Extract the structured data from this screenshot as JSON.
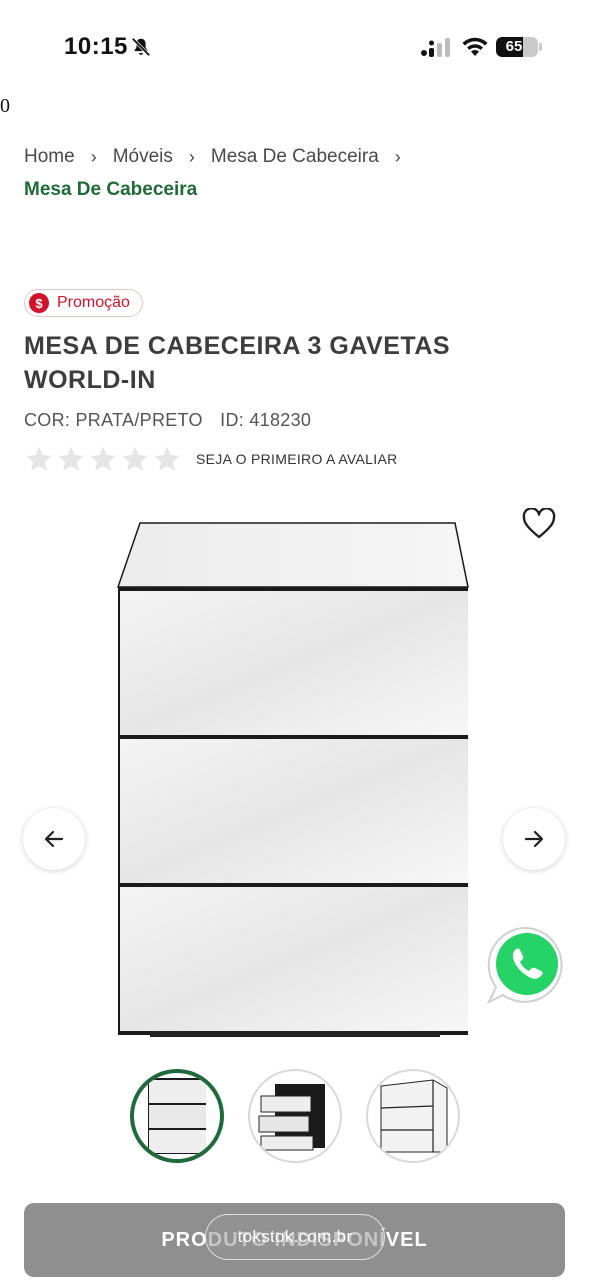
{
  "status_bar": {
    "time": "10:15",
    "battery": "65",
    "battery_level": 0.65
  },
  "stray_char": "0",
  "breadcrumb": {
    "items": [
      "Home",
      "Móveis",
      "Mesa De Cabeceira"
    ],
    "current": "Mesa De Cabeceira"
  },
  "promo": {
    "icon_symbol": "$",
    "label": "Promoção"
  },
  "product": {
    "title": "MESA DE CABECEIRA 3 GAVETAS WORLD-IN",
    "color": "COR: PRATA/PRETO",
    "id": "ID: 418230",
    "rating_stars": 0,
    "rating_text": "SEJA O PRIMEIRO A AVALIAR"
  },
  "cta": {
    "label": "PRODUTO INDISPONÍVEL"
  },
  "browser": {
    "url": "tokstok.com.br"
  },
  "colors": {
    "brand_green": "#1e6b39",
    "promo_red": "#d1132a",
    "cta_gray": "#8f8f8f",
    "whatsapp_green": "#25d366"
  }
}
